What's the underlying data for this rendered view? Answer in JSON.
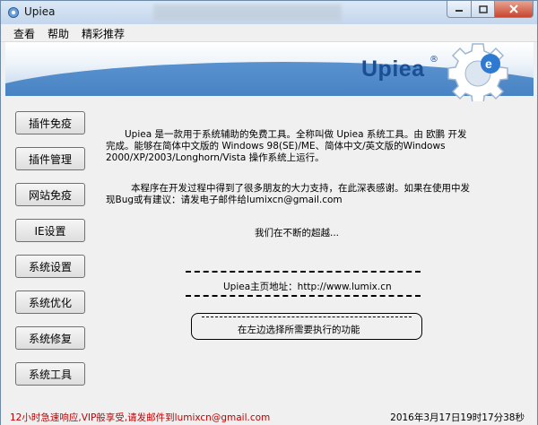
{
  "window": {
    "title": "Upiea"
  },
  "menu": {
    "items": [
      "查看",
      "帮助",
      "精彩推荐"
    ]
  },
  "banner": {
    "logo": "Upiea",
    "registered": "®"
  },
  "sidebar": {
    "items": [
      "插件免疫",
      "插件管理",
      "网站免疫",
      "IE设置",
      "系统设置",
      "系统优化",
      "系统修复",
      "系统工具"
    ]
  },
  "main": {
    "intro_line1": "Upiea 是一款用于系统辅助的免费工具。全称叫做 Upiea 系统工具。由 欧鹏 开发",
    "intro_line2": "完成。能够在简体中文版的 Windows 98(SE)/ME、简体中文/英文版的Windows",
    "intro_line3": "2000/XP/2003/Longhorn/Vista 操作系统上运行。",
    "thanks_line1": "本程序在开发过程中得到了很多朋友的大力支持，在此深表感谢。如果在使用中发",
    "thanks_line2": "现Bug或有建议：请发电子邮件给lumixcn@gmail.com",
    "slogan": "我们在不断的超越...",
    "homepage": "Upiea主页地址：http://www.lumix.cn",
    "prompt": "在左边选择所需要执行的功能"
  },
  "status": {
    "left": "12小时急速响应,VIP般享受,请发邮件到lumixcn@gmail.com",
    "right": "2016年3月17日19时17分38秒"
  },
  "colors": {
    "status_left": "#c00000",
    "logo": "#1c4e94",
    "banner_blue": "#2f6fb5"
  }
}
